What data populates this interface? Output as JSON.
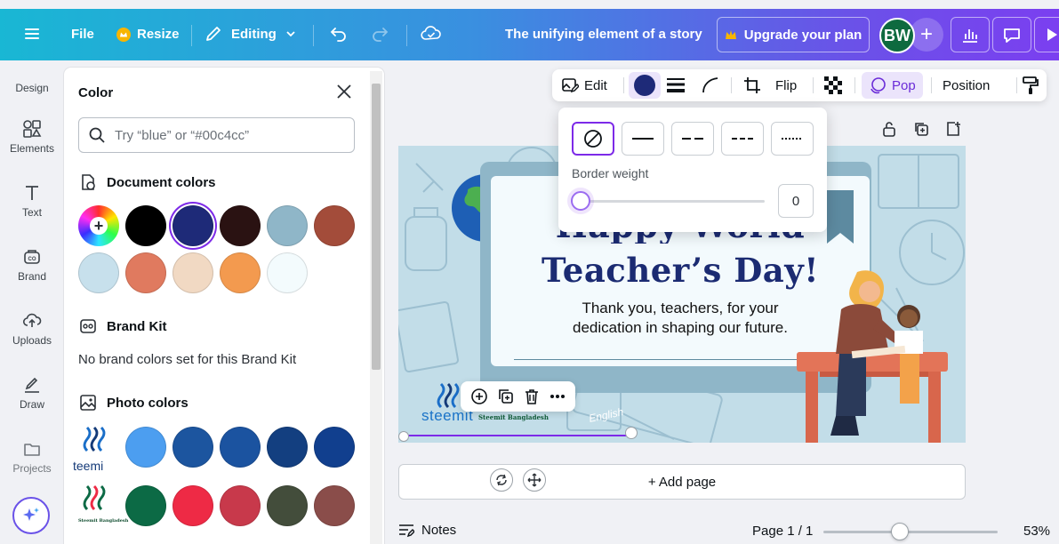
{
  "topbar": {
    "file_label": "File",
    "resize_label": "Resize",
    "editing_label": "Editing",
    "doc_title": "The unifying element of a story",
    "upgrade_label": "Upgrade your plan",
    "avatar_initials": "BW",
    "add_label": "+",
    "gradient_colors": [
      "#19b7d4",
      "#3a8fe0",
      "#6a52e8",
      "#7b3ff0"
    ]
  },
  "rail": {
    "items": [
      {
        "label": "Design",
        "icon": "design-icon"
      },
      {
        "label": "Elements",
        "icon": "elements-icon"
      },
      {
        "label": "Text",
        "icon": "text-icon"
      },
      {
        "label": "Brand",
        "icon": "brand-icon"
      },
      {
        "label": "Uploads",
        "icon": "uploads-icon"
      },
      {
        "label": "Draw",
        "icon": "draw-icon"
      },
      {
        "label": "Projects",
        "icon": "projects-icon"
      }
    ]
  },
  "color_panel": {
    "title": "Color",
    "search_placeholder": "Try “blue” or “#00c4cc”",
    "document_colors_label": "Document colors",
    "document_colors": [
      "#000000",
      "#1e2a78",
      "#2a1212",
      "#8fb6c8",
      "#a34c3a",
      "#c7e0ec",
      "#e07a5f",
      "#f1d9c3",
      "#f39a4f",
      "#f3fbfd"
    ],
    "selected_document_color": "#1e2a78",
    "brand_kit_label": "Brand Kit",
    "brand_kit_note": "No brand colors set for this Brand Kit",
    "photo_colors_label": "Photo colors",
    "photo_row_1": [
      "#4c9ef0",
      "#1c559f",
      "#1b53a0",
      "#133f80",
      "#113f8e"
    ],
    "photo_row_2": [
      "#0c6a45",
      "#ee2a45",
      "#c8394b",
      "#434d3b",
      "#8a4d4a"
    ],
    "photo_1_text": "teemi",
    "photo_2_text": "Steemit Bangladesh"
  },
  "context_bar": {
    "edit_label": "Edit",
    "flip_label": "Flip",
    "pop_label": "Pop",
    "position_label": "Position",
    "current_color": "#1e2a78"
  },
  "border_popover": {
    "styles": [
      "none",
      "solid",
      "long-dash",
      "dash",
      "dotted"
    ],
    "selected_style": "none",
    "weight_label": "Border weight",
    "weight_value": "0"
  },
  "design": {
    "headline_line_1": "Happy World",
    "headline_line_2": "Teacher’s Day!",
    "subtext_line_1": "Thank you, teachers, for your",
    "subtext_line_2": "dedication in shaping our future.",
    "logo_text": "steemit",
    "logo_sub": "Steemit Bangladesh",
    "book_text": "English",
    "bg_color": "#c2dde8"
  },
  "canvas": {
    "add_page_label": "+ Add page"
  },
  "footer": {
    "notes_label": "Notes",
    "page_label": "Page 1 / 1",
    "zoom_label": "53%",
    "zoom_percent": 53
  }
}
